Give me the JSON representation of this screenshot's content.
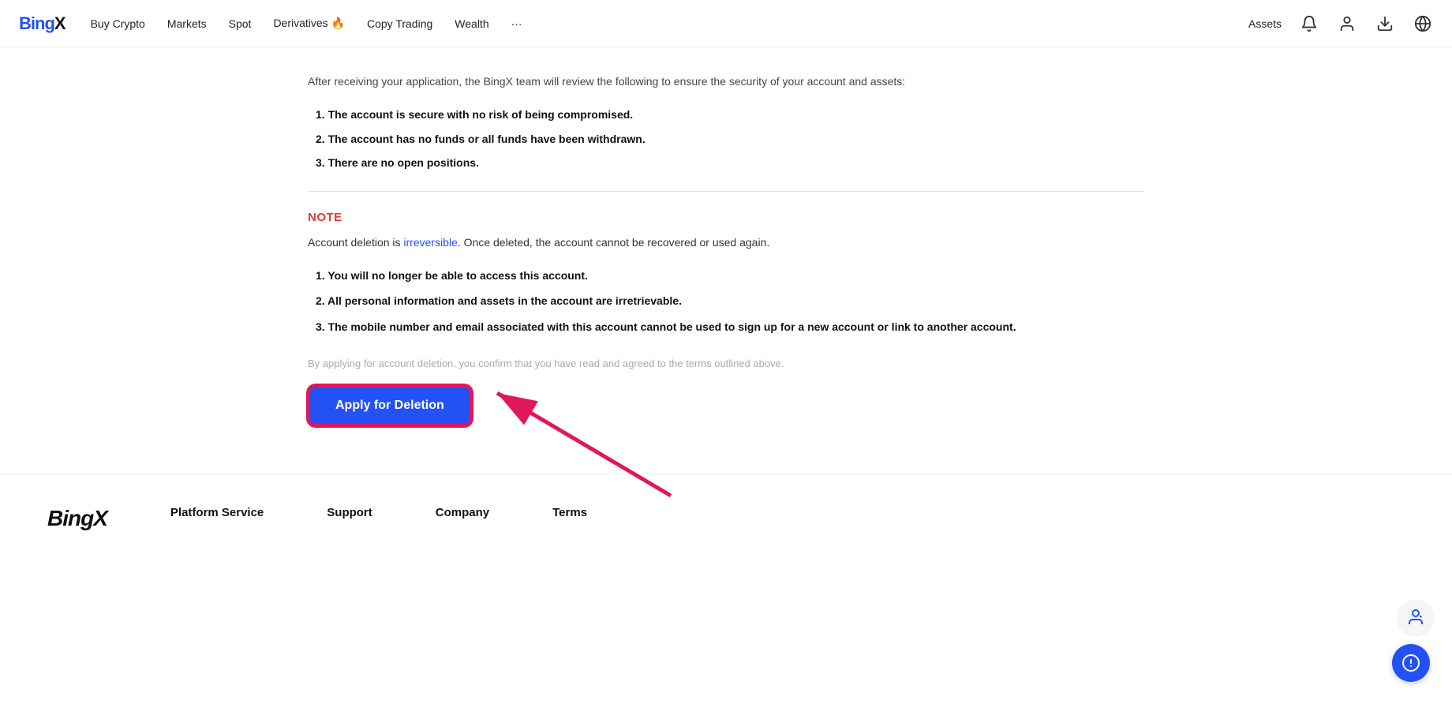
{
  "brand": {
    "name": "BingX"
  },
  "navbar": {
    "links": [
      {
        "label": "Buy Crypto",
        "id": "buy-crypto"
      },
      {
        "label": "Markets",
        "id": "markets"
      },
      {
        "label": "Spot",
        "id": "spot"
      },
      {
        "label": "Derivatives 🔥",
        "id": "derivatives"
      },
      {
        "label": "Copy Trading",
        "id": "copy-trading"
      },
      {
        "label": "Wealth",
        "id": "wealth"
      },
      {
        "label": "···",
        "id": "more"
      }
    ],
    "assets_label": "Assets"
  },
  "main": {
    "intro_text": "After receiving your application, the BingX team will review the following to ensure the security of your account and assets:",
    "review_items": [
      "1. The account is secure with no risk of being compromised.",
      "2. The account has no funds or all funds have been withdrawn.",
      "3. There are no open positions."
    ],
    "note_label": "NOTE",
    "note_desc_plain": "Account deletion is ",
    "note_desc_highlight": "irreversible",
    "note_desc_suffix": ". Once deleted, the account cannot be recovered or used again.",
    "consequence_items": [
      "1. You will no longer be able to access this account.",
      "2. All personal information and assets in the account are irretrievable.",
      "3. The mobile number and email associated with this account cannot be used to sign up for a new account or link to another account."
    ],
    "confirm_text": "By applying for account deletion, you confirm that you have read and agreed to the terms outlined above.",
    "apply_btn_label": "Apply for Deletion"
  },
  "footer": {
    "logo": "BingX",
    "columns": [
      {
        "heading": "Platform Service"
      },
      {
        "heading": "Support"
      },
      {
        "heading": "Company"
      },
      {
        "heading": "Terms"
      }
    ]
  }
}
